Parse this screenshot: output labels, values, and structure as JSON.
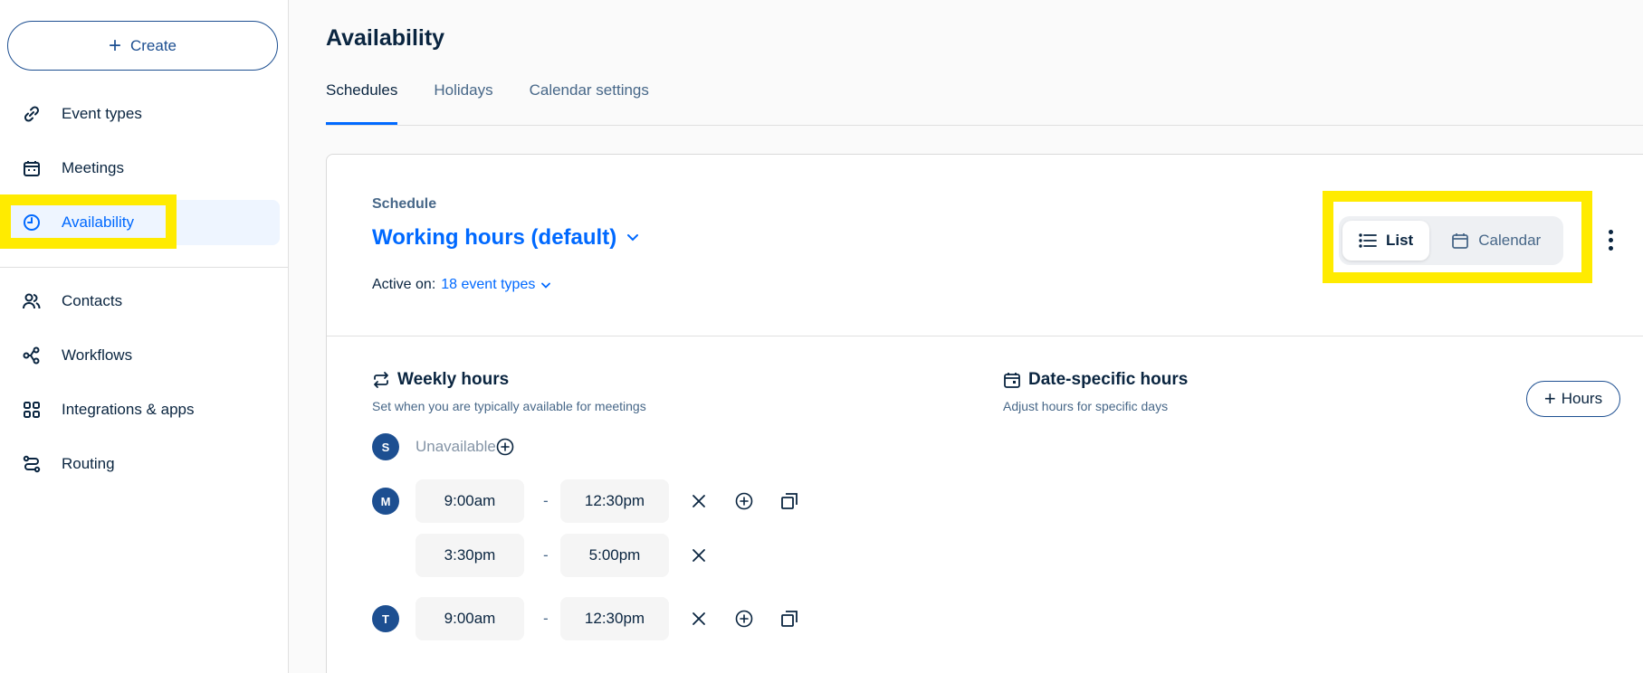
{
  "sidebar": {
    "create_label": "Create",
    "items": [
      {
        "label": "Event types",
        "icon": "link-icon"
      },
      {
        "label": "Meetings",
        "icon": "calendar-icon"
      },
      {
        "label": "Availability",
        "icon": "clock-icon"
      },
      {
        "label": "Contacts",
        "icon": "contacts-icon"
      },
      {
        "label": "Workflows",
        "icon": "workflow-icon"
      },
      {
        "label": "Integrations & apps",
        "icon": "grid-icon"
      },
      {
        "label": "Routing",
        "icon": "routing-icon"
      }
    ],
    "active": "Availability"
  },
  "header": {
    "title": "Availability",
    "tabs": [
      {
        "label": "Schedules",
        "active": true
      },
      {
        "label": "Holidays",
        "active": false
      },
      {
        "label": "Calendar settings",
        "active": false
      }
    ]
  },
  "schedule": {
    "label": "Schedule",
    "name": "Working hours (default)",
    "active_on_label": "Active on:",
    "active_on_value": "18 event types",
    "view_toggle": {
      "list_label": "List",
      "calendar_label": "Calendar",
      "selected": "List"
    }
  },
  "weekly": {
    "title": "Weekly hours",
    "subtitle": "Set when you are typically available for meetings",
    "days": [
      {
        "letter": "S",
        "unavailable_text": "Unavailable",
        "slots": []
      },
      {
        "letter": "M",
        "slots": [
          {
            "start": "9:00am",
            "end": "12:30pm"
          },
          {
            "start": "3:30pm",
            "end": "5:00pm"
          }
        ]
      },
      {
        "letter": "T",
        "slots": [
          {
            "start": "9:00am",
            "end": "12:30pm"
          }
        ]
      }
    ],
    "separator": "-"
  },
  "date_specific": {
    "title": "Date-specific hours",
    "subtitle": "Adjust hours for specific days",
    "add_label": "Hours"
  },
  "colors": {
    "accent": "#0069ff",
    "navy": "#1d4f91",
    "highlight": "#ffeb00"
  }
}
